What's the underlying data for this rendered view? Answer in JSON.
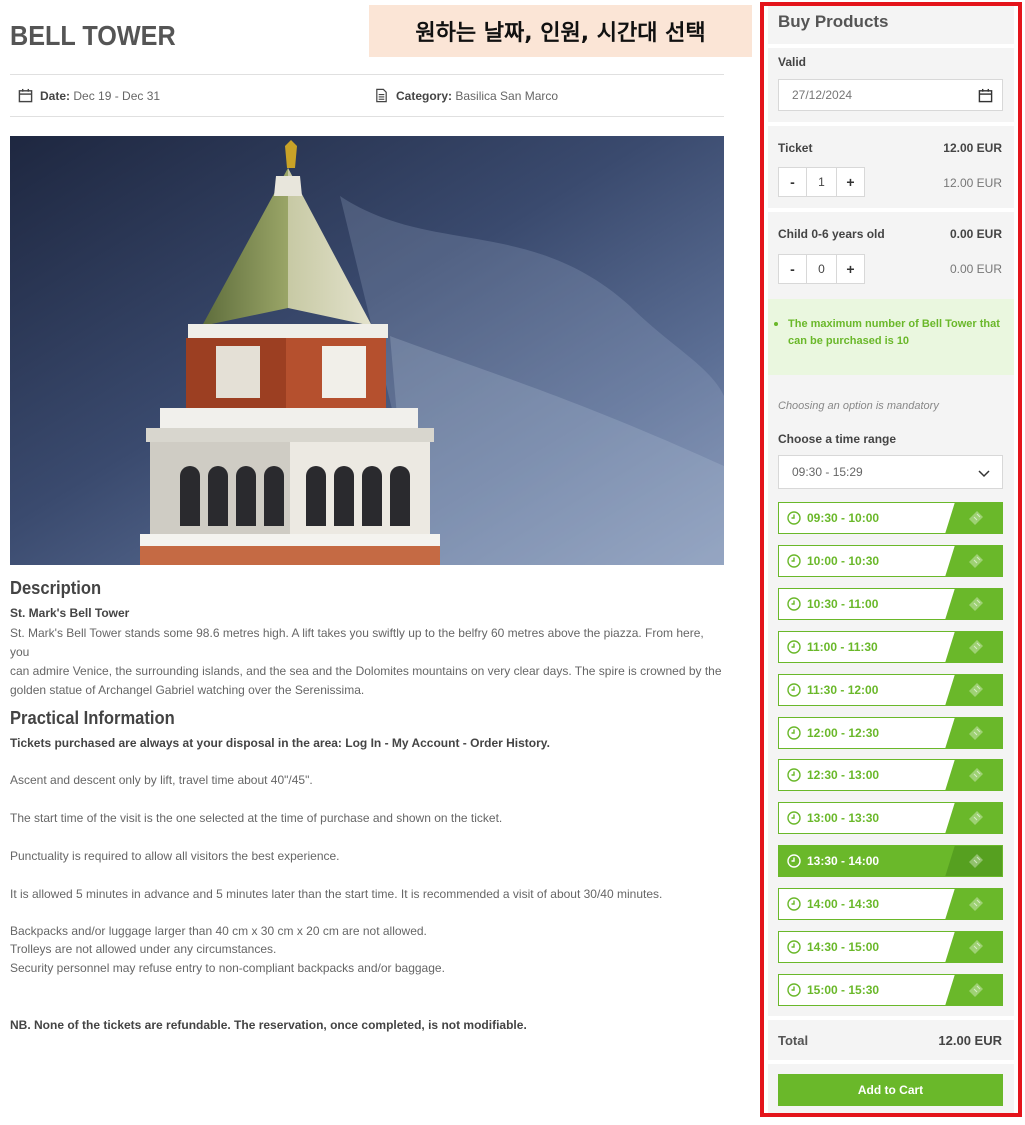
{
  "overlay": {
    "note": "원하는 날짜, 인원, 시간대 선택"
  },
  "page": {
    "title": "BELL TOWER"
  },
  "meta": {
    "date_label": "Date:",
    "date_value": "Dec 19 - Dec 31",
    "category_label": "Category:",
    "category_value": "Basilica San Marco"
  },
  "description": {
    "title": "Description",
    "subtitle": "St. Mark's Bell Tower",
    "lines": [
      "St. Mark's Bell Tower stands some 98.6 metres high. A lift takes you swiftly up to the belfry 60 metres above the piazza. From here, you",
      "can admire Venice, the surrounding islands, and the sea and the Dolomites mountains on very clear days. The spire is crowned by the",
      "golden statue of Archangel Gabriel watching over the Serenissima."
    ]
  },
  "practical": {
    "title": "Practical Information",
    "disposal": "Tickets purchased are always at your disposal in the area: Log In - My Account - Order History.",
    "ascent": "Ascent and descent only by lift, travel time about 40\"/45\".",
    "start_time": "The start time of the visit is the one selected at the time of purchase and shown on the ticket.",
    "punctuality": "Punctuality is required to allow all visitors the best experience.",
    "allowed": "It is allowed 5 minutes in advance and 5 minutes later than the start time. It is recommended a visit of about 30/40 minutes.",
    "backpacks": "Backpacks and/or luggage larger than 40 cm x 30 cm x 20 cm are not allowed.",
    "trolleys": "Trolleys are not allowed under any circumstances.",
    "security": "Security personnel may refuse entry to non-compliant backpacks and/or baggage.",
    "nb": "NB. None of the tickets are refundable. The reservation, once completed, is not modifiable."
  },
  "sidebar": {
    "title": "Buy Products",
    "valid_label": "Valid",
    "valid_date": "27/12/2024",
    "ticket": {
      "label": "Ticket",
      "price": "12.00 EUR",
      "qty": "1",
      "subtotal": "12.00 EUR"
    },
    "child": {
      "label": "Child 0-6 years old",
      "price": "0.00 EUR",
      "qty": "0",
      "subtotal": "0.00 EUR"
    },
    "minus": "-",
    "plus": "+",
    "notice": "The maximum number of Bell Tower that can be purchased is 10",
    "mandatory": "Choosing an option is mandatory",
    "time_range_label": "Choose a time range",
    "time_range_value": "09:30 - 15:29",
    "slots": [
      "09:30 - 10:00",
      "10:00 - 10:30",
      "10:30 - 11:00",
      "11:00 - 11:30",
      "11:30 - 12:00",
      "12:00 - 12:30",
      "12:30 - 13:00",
      "13:00 - 13:30",
      "13:30 - 14:00",
      "14:00 - 14:30",
      "14:30 - 15:00",
      "15:00 - 15:30"
    ],
    "selected_slot": "13:30 - 14:00",
    "total_label": "Total",
    "total_value": "12.00 EUR",
    "add_to_cart": "Add to Cart"
  },
  "colors": {
    "accent": "#6ab82a",
    "frame": "#e4141b",
    "overlay_bg": "#fbe5d6"
  }
}
